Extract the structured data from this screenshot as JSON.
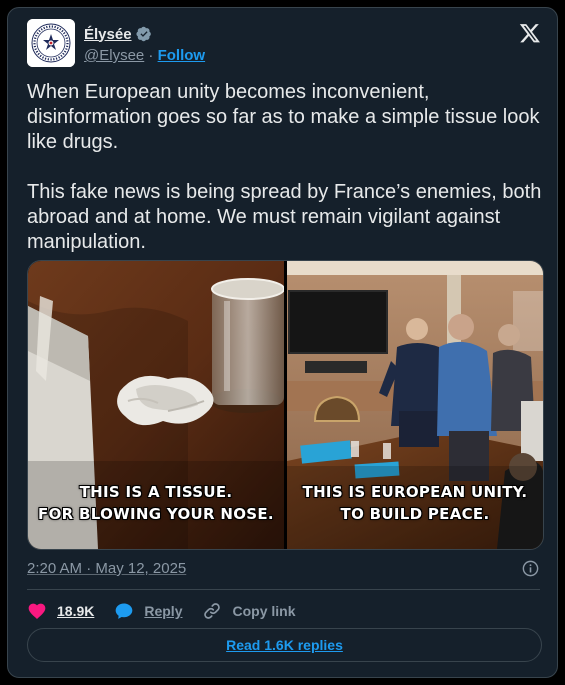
{
  "author": {
    "display_name": "Élysée",
    "handle": "@Elysee",
    "separator": "·",
    "follow_label": "Follow",
    "verified": true,
    "avatar_icon": "elysee-seal-logo",
    "avatar_seal_text": "PRÉSIDENCE DE LA RÉPUBLIQUE"
  },
  "tweet": {
    "paragraphs": [
      "When European unity becomes inconvenient, disinformation goes so far as to make a simple tissue look like drugs.",
      "This fake news is being spread by France’s enemies, both abroad and at home. We must remain vigilant against manipulation."
    ],
    "timestamp": "2:20 AM · May 12, 2025"
  },
  "media": {
    "left_caption": [
      "THIS IS A TISSUE.",
      "FOR BLOWING YOUR NOSE."
    ],
    "right_caption": [
      "THIS IS EUROPEAN UNITY.",
      "TO BUILD PEACE."
    ]
  },
  "actions": {
    "like_count": "18.9K",
    "reply_label": "Reply",
    "copy_link_label": "Copy link"
  },
  "read_replies_label": "Read 1.6K replies",
  "colors": {
    "background": "#15202b",
    "accent": "#1d9bf0",
    "like": "#f91880",
    "text": "#e7e9ea",
    "muted": "#8b98a5",
    "border": "#38444d"
  },
  "icons": [
    "verified-badge-icon",
    "x-logo-icon",
    "info-icon",
    "heart-icon",
    "reply-bubble-icon",
    "link-icon"
  ]
}
